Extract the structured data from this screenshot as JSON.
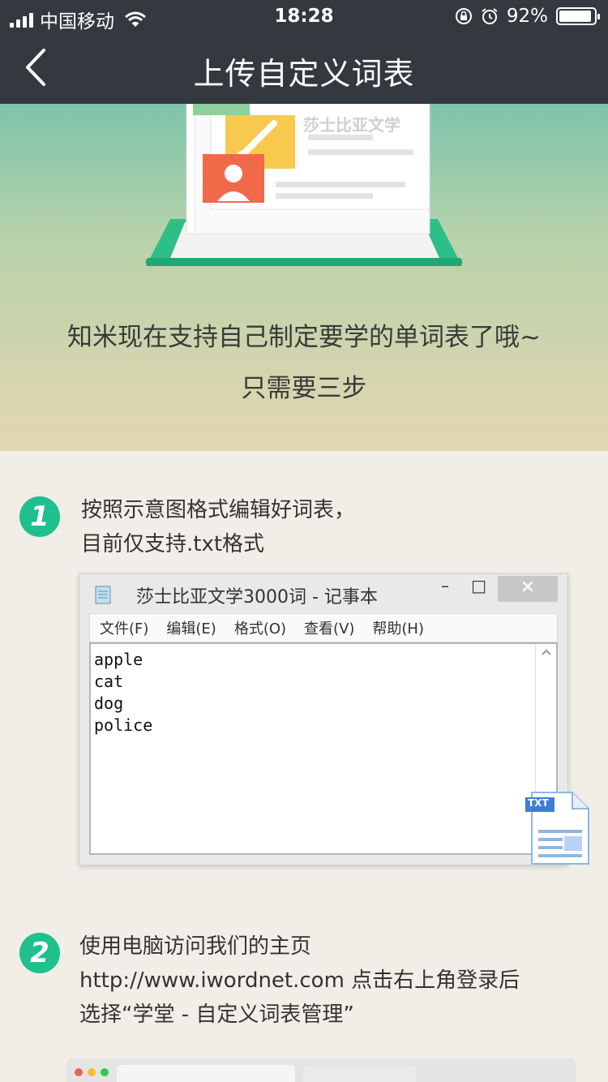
{
  "status_bar": {
    "carrier": "中国移动",
    "time": "18:28",
    "battery_percent": "92%",
    "battery_level": 0.92
  },
  "nav": {
    "title": "上传自定义词表",
    "back_icon": "chevron-left-icon"
  },
  "hero": {
    "card_label": "莎士比亚文学",
    "line1": "知米现在支持自己制定要学的单词表了哦~",
    "line2": "只需要三步"
  },
  "steps": [
    {
      "number": "1",
      "lines": [
        "按照示意图格式编辑好词表，",
        "目前仅支持.txt格式"
      ]
    },
    {
      "number": "2",
      "lines": [
        "使用电脑访问我们的主页",
        "http://www.iwordnet.com  点击右上角登录后",
        "选择“学堂 - 自定义词表管理”"
      ]
    }
  ],
  "notepad": {
    "title": "莎士比亚文学3000词 - 记事本",
    "minimize": "–",
    "maximize": "□",
    "close": "✕",
    "menu": [
      "文件(F)",
      "编辑(E)",
      "格式(O)",
      "查看(V)",
      "帮助(H)"
    ],
    "lines": [
      "apple",
      "cat",
      "dog",
      "police"
    ],
    "file_badge": "TXT"
  },
  "colors": {
    "topbar": "#34383f",
    "accent_green": "#1fbf8e",
    "page_bg": "#f1ede7"
  }
}
